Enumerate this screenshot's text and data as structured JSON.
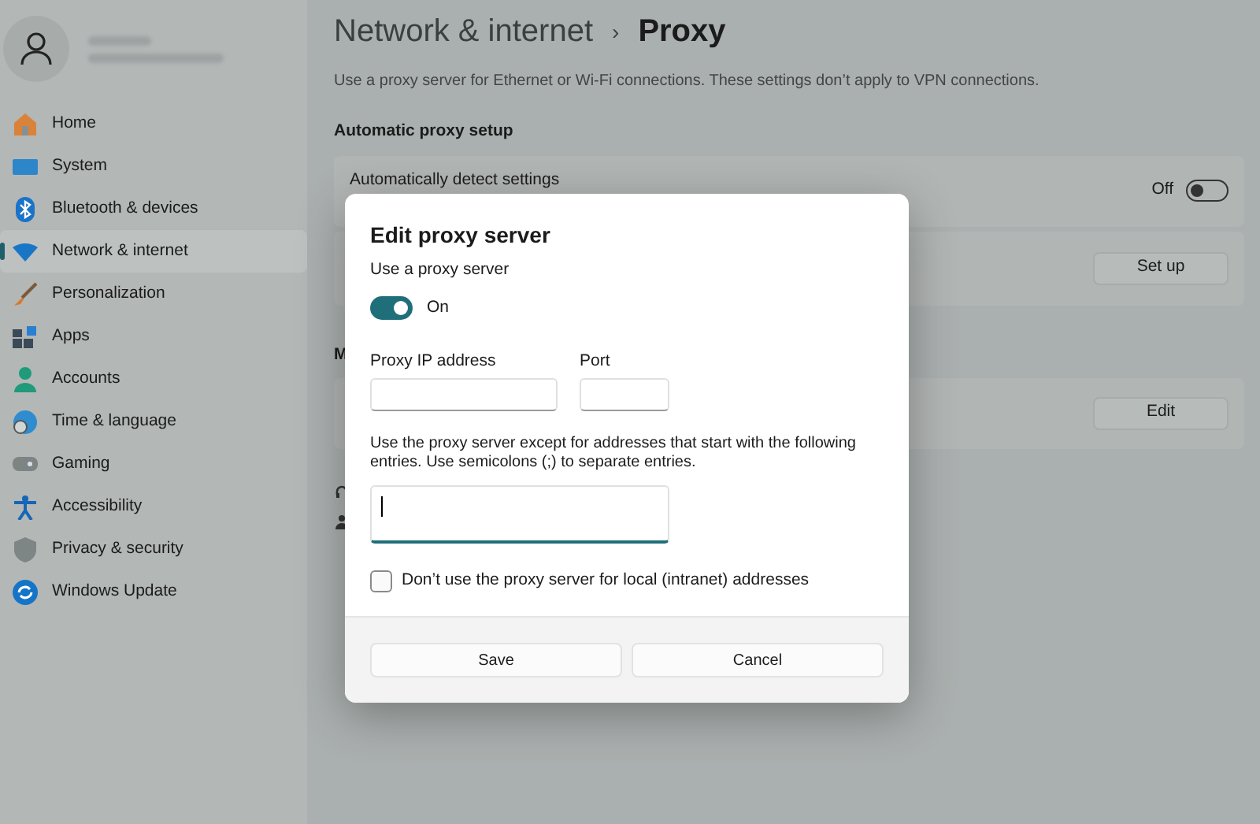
{
  "sidebar": {
    "items": [
      {
        "label": "Home",
        "selected": false
      },
      {
        "label": "System",
        "selected": false
      },
      {
        "label": "Bluetooth & devices",
        "selected": false
      },
      {
        "label": "Network & internet",
        "selected": true
      },
      {
        "label": "Personalization",
        "selected": false
      },
      {
        "label": "Apps",
        "selected": false
      },
      {
        "label": "Accounts",
        "selected": false
      },
      {
        "label": "Time & language",
        "selected": false
      },
      {
        "label": "Gaming",
        "selected": false
      },
      {
        "label": "Accessibility",
        "selected": false
      },
      {
        "label": "Privacy & security",
        "selected": false
      },
      {
        "label": "Windows Update",
        "selected": false
      }
    ]
  },
  "header": {
    "section": "Network & internet",
    "separator": "›",
    "page": "Proxy"
  },
  "description": "Use a proxy server for Ethernet or Wi-Fi connections. These settings don’t apply to VPN connections.",
  "automatic_heading": "Automatic proxy setup",
  "auto_detect": {
    "label": "Automatically detect settings",
    "state_text": "Off",
    "on": false
  },
  "setup_script": {
    "button": "Set up"
  },
  "manual_heading": "M",
  "manual": {
    "button": "Edit"
  },
  "dialog": {
    "title": "Edit proxy server",
    "use_proxy_label": "Use a proxy server",
    "use_proxy_on": true,
    "use_proxy_state_text": "On",
    "ip_label": "Proxy IP address",
    "port_label": "Port",
    "exceptions_text": "Use the proxy server except for addresses that start with the following entries. Use semicolons (;) to separate entries.",
    "local_label": "Don’t use the proxy server for local (intranet) addresses",
    "local_checked": false,
    "buttons": [
      "Save",
      "Cancel"
    ]
  }
}
